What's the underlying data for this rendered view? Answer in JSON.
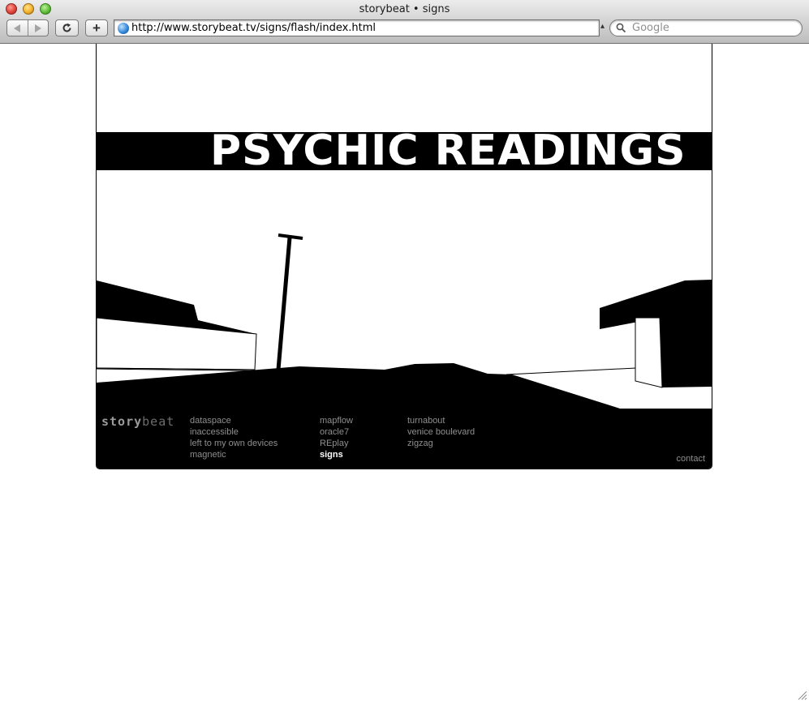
{
  "window": {
    "title": "storybeat • signs"
  },
  "toolbar": {
    "back_icon": "back-arrow-icon",
    "forward_icon": "forward-arrow-icon",
    "reload_icon": "reload-icon",
    "new_tab_label": "+"
  },
  "address_bar": {
    "url": "http://www.storybeat.tv/signs/flash/index.html"
  },
  "search": {
    "placeholder": "Google"
  },
  "page": {
    "headline": "PSYCHIC READINGS",
    "logo": {
      "dark_part": "story",
      "light_part": "beat"
    },
    "nav_columns": [
      {
        "items": [
          "dataspace",
          "inaccessible",
          "left to my own devices",
          "magnetic"
        ]
      },
      {
        "items": [
          "mapflow",
          "oracle7",
          "REplay",
          "signs"
        ]
      },
      {
        "items": [
          "turnabout",
          "venice boulevard",
          "zigzag"
        ]
      }
    ],
    "active_item": "signs",
    "contact_label": "contact"
  },
  "colors": {
    "stage_background": "#000000",
    "nav_text": "#8f8f8f",
    "active_nav_text": "#ffffff"
  }
}
